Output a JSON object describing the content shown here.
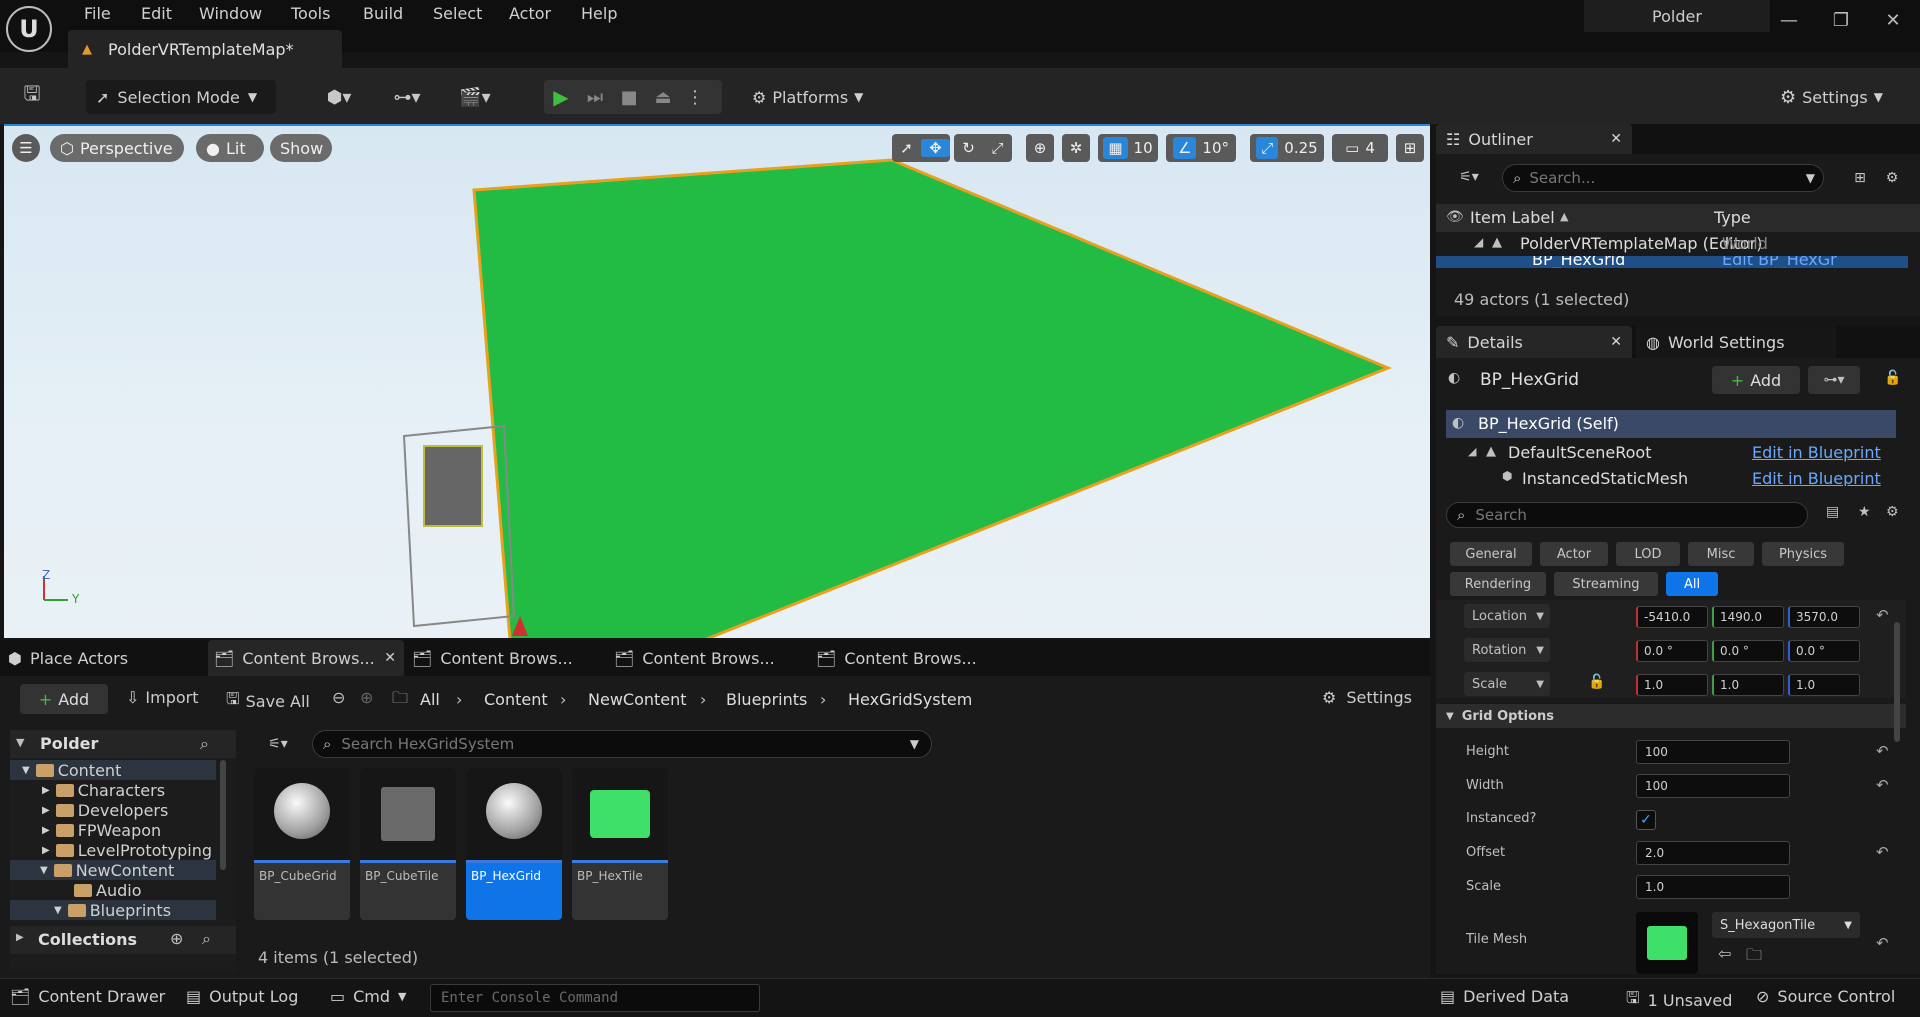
{
  "app": {
    "project_name": "Polder",
    "logo_letter": "U"
  },
  "menu": [
    "File",
    "Edit",
    "Window",
    "Tools",
    "Build",
    "Select",
    "Actor",
    "Help"
  ],
  "level_tab": {
    "label": "PolderVRTemplateMap*"
  },
  "toolbar": {
    "mode_label": "Selection Mode",
    "platforms_label": "Platforms",
    "settings_label": "Settings"
  },
  "viewport": {
    "perspective_label": "Perspective",
    "lit_label": "Lit",
    "show_label": "Show",
    "grid_snap": "10",
    "rotation_snap": "10°",
    "scale_snap": "0.25",
    "camera_speed": "4",
    "axis_z": "Z",
    "axis_y": "Y",
    "plane_color": "#22bb44"
  },
  "outliner": {
    "tab_label": "Outliner",
    "search_placeholder": "Search...",
    "col_label": "Item Label",
    "col_label_sort": "▲",
    "col_type": "Type",
    "rows": [
      {
        "label": "PolderVRTemplateMap (Editor)",
        "type": "World"
      },
      {
        "label": "BP_HexGrid",
        "type": "Edit BP_HexGr"
      }
    ],
    "status": "49 actors (1 selected)"
  },
  "details": {
    "tab_label": "Details",
    "world_settings_label": "World Settings",
    "actor_name": "BP_HexGrid",
    "add_label": "Add",
    "components": [
      {
        "label": "BP_HexGrid (Self)",
        "link": ""
      },
      {
        "label": "DefaultSceneRoot",
        "link": "Edit in Blueprint"
      },
      {
        "label": "InstancedStaticMesh",
        "link": "Edit in Blueprint"
      }
    ],
    "search_placeholder": "Search",
    "categories_row1": [
      "General",
      "Actor",
      "LOD",
      "Misc",
      "Physics"
    ],
    "categories_row2": [
      "Rendering",
      "Streaming",
      "All"
    ],
    "location": {
      "label": "Location",
      "x": "-5410.0",
      "y": "1490.0",
      "z": "3570.0"
    },
    "rotation": {
      "label": "Rotation",
      "x": "0.0 °",
      "y": "0.0 °",
      "z": "0.0 °"
    },
    "scale": {
      "label": "Scale",
      "x": "1.0",
      "y": "1.0",
      "z": "1.0"
    },
    "grid_options_label": "Grid Options",
    "grid": {
      "height_label": "Height",
      "height": "100",
      "width_label": "Width",
      "width": "100",
      "instanced_label": "Instanced?",
      "instanced": true,
      "offset_label": "Offset",
      "offset": "2.0",
      "scale_label": "Scale",
      "scale": "1.0",
      "tile_mesh_label": "Tile Mesh",
      "tile_mesh": "S_HexagonTile"
    }
  },
  "content_browser": {
    "tabs": [
      "Place Actors",
      "Content Brows...",
      "Content Brows...",
      "Content Brows...",
      "Content Brows..."
    ],
    "add_label": "Add",
    "import_label": "Import",
    "save_all_label": "Save All",
    "breadcrumb": [
      "All",
      "Content",
      "NewContent",
      "Blueprints",
      "HexGridSystem"
    ],
    "settings_label": "Settings",
    "root_label": "Polder",
    "tree": [
      {
        "label": "Content",
        "depth": 0,
        "open": true
      },
      {
        "label": "Characters",
        "depth": 1,
        "open": false
      },
      {
        "label": "Developers",
        "depth": 1,
        "open": false
      },
      {
        "label": "FPWeapon",
        "depth": 1,
        "open": false
      },
      {
        "label": "LevelPrototyping",
        "depth": 1,
        "open": false
      },
      {
        "label": "NewContent",
        "depth": 1,
        "open": true
      },
      {
        "label": "Audio",
        "depth": 2,
        "open": false
      },
      {
        "label": "Blueprints",
        "depth": 2,
        "open": true
      }
    ],
    "collections_label": "Collections",
    "search_placeholder": "Search HexGridSystem",
    "assets": [
      {
        "name": "BP_CubeGrid",
        "kind": "blueprint"
      },
      {
        "name": "BP_CubeTile",
        "kind": "cube-gray"
      },
      {
        "name": "BP_HexGrid",
        "kind": "blueprint",
        "selected": true
      },
      {
        "name": "BP_HexTile",
        "kind": "cube-green"
      }
    ],
    "item_count": "4 items (1 selected)"
  },
  "statusbar": {
    "content_drawer": "Content Drawer",
    "output_log": "Output Log",
    "cmd": "Cmd",
    "console_placeholder": "Enter Console Command",
    "derived_data": "Derived Data",
    "unsaved": "1 Unsaved",
    "source_control": "Source Control"
  },
  "colors": {
    "accent": "#2a86d8",
    "selected": "#0f74e8",
    "green_play": "#3fbf3f"
  }
}
